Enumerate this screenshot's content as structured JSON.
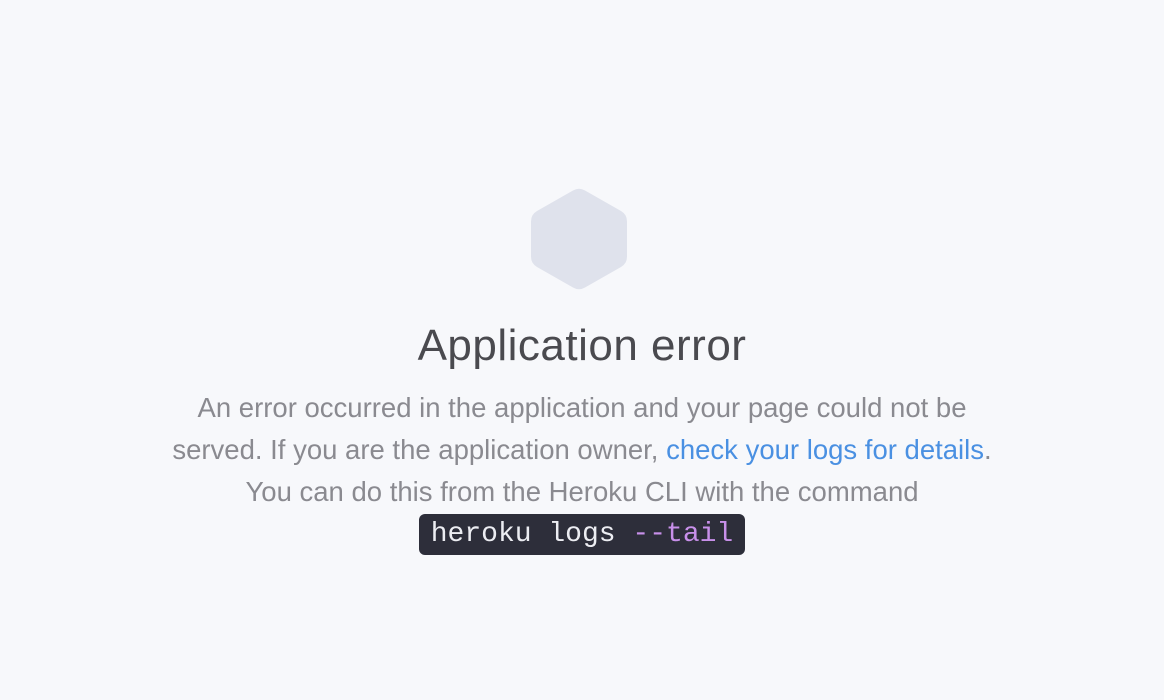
{
  "page": {
    "background": "#f7f8fb"
  },
  "icon": {
    "name": "hexagon-icon",
    "color": "#dfe2ec"
  },
  "title": "Application error",
  "message": {
    "line1": "An error occurred in the application and your page could not be",
    "line2_before": "served. If you are the application owner,",
    "link_text": "check your logs for details",
    "line2_after": ".",
    "line3": "You can do this from the Heroku CLI with the command"
  },
  "command": {
    "base": "heroku logs",
    "flag": "--tail"
  },
  "colors": {
    "link": "#4a90e2",
    "command_bg": "#2d2e3a",
    "command_text": "#ecedf2",
    "command_flag": "#c890ea"
  }
}
